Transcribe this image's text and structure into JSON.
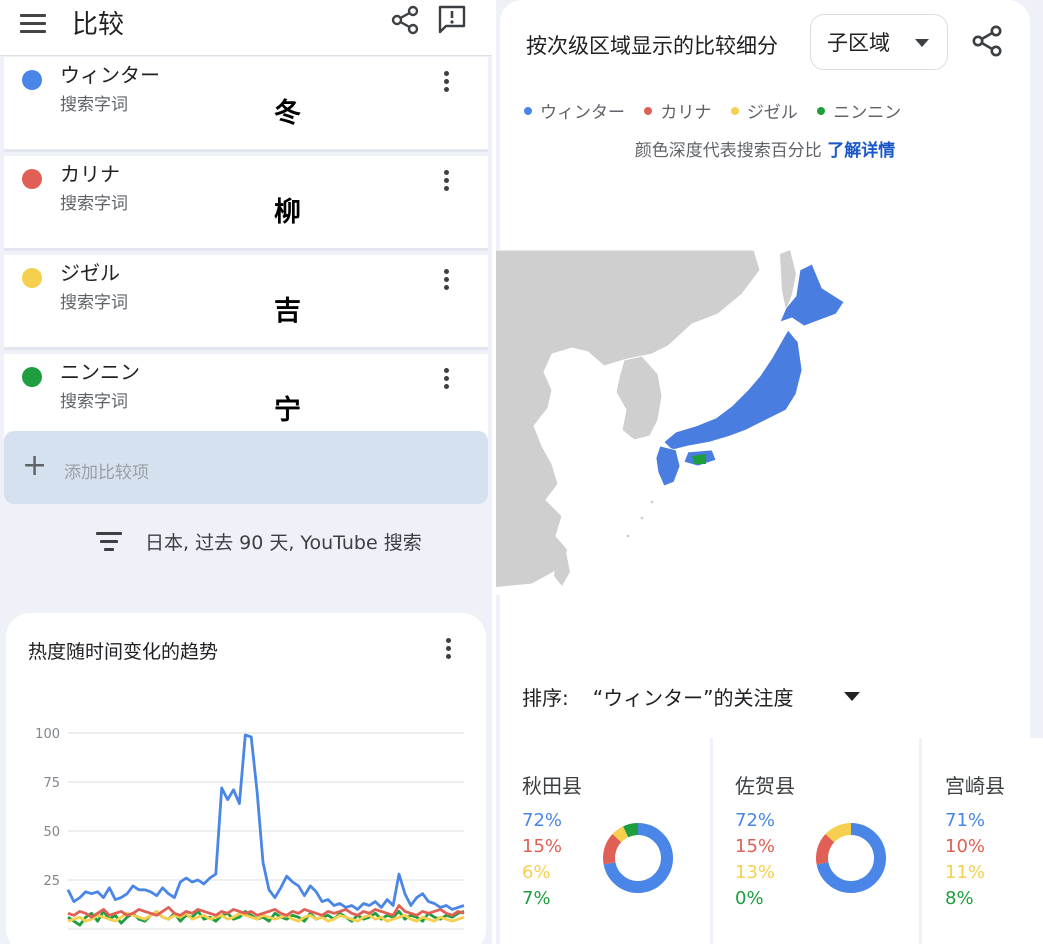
{
  "header": {
    "title": "比较"
  },
  "terms": [
    {
      "name": "ウィンター",
      "sub": "搜索字词",
      "mark": "冬",
      "color": "#4a86e8"
    },
    {
      "name": "カリナ",
      "sub": "搜索字词",
      "mark": "柳",
      "color": "#e06055"
    },
    {
      "name": "ジゼル",
      "sub": "搜索字词",
      "mark": "吉",
      "color": "#f6cf4e"
    },
    {
      "name": "ニンニン",
      "sub": "搜索字词",
      "mark": "宁",
      "color": "#1e9e3e"
    }
  ],
  "add_term": {
    "plus": "+",
    "label": "添加比较项"
  },
  "filter": {
    "text": "日本, 过去 90 天, YouTube 搜索"
  },
  "trend": {
    "title": "热度随时间变化的趋势"
  },
  "chart_data": {
    "type": "line",
    "title": "热度随时间变化的趋势",
    "yticks": [
      25,
      50,
      75,
      100
    ],
    "ylim": [
      0,
      100
    ],
    "grid": true,
    "series": [
      {
        "name": "ウィンター",
        "color": "#4a86e8",
        "values": [
          20,
          14,
          16,
          19,
          18,
          19,
          16,
          21,
          15,
          16,
          18,
          22,
          20,
          20,
          19,
          17,
          21,
          18,
          16,
          24,
          26,
          24,
          25,
          23,
          26,
          28,
          72,
          66,
          71,
          64,
          99,
          98,
          70,
          34,
          20,
          16,
          21,
          27,
          24,
          22,
          17,
          22,
          19,
          14,
          15,
          12,
          13,
          11,
          12,
          10,
          13,
          12,
          14,
          11,
          15,
          12,
          28,
          18,
          12,
          16,
          18,
          14,
          13,
          11,
          12,
          10,
          11,
          12
        ]
      },
      {
        "name": "カリナ",
        "color": "#e06055",
        "values": [
          8,
          7,
          9,
          8,
          6,
          8,
          10,
          7,
          8,
          9,
          7,
          8,
          10,
          9,
          8,
          7,
          9,
          11,
          8,
          7,
          9,
          8,
          10,
          9,
          8,
          7,
          9,
          8,
          10,
          9,
          8,
          9,
          7,
          8,
          9,
          10,
          8,
          7,
          9,
          8,
          10,
          9,
          8,
          7,
          9,
          8,
          9,
          10,
          8,
          7,
          9,
          8,
          10,
          9,
          8,
          7,
          12,
          9,
          8,
          7,
          9,
          8,
          9,
          10,
          8,
          7,
          9,
          8
        ]
      },
      {
        "name": "ジゼル",
        "color": "#f6cf4e",
        "values": [
          4,
          5,
          6,
          4,
          5,
          7,
          6,
          5,
          4,
          6,
          8,
          7,
          6,
          5,
          7,
          9,
          6,
          5,
          7,
          6,
          8,
          5,
          6,
          7,
          5,
          6,
          7,
          5,
          6,
          8,
          7,
          6,
          5,
          7,
          6,
          5,
          6,
          7,
          5,
          4,
          6,
          7,
          5,
          6,
          4,
          5,
          7,
          6,
          5,
          4,
          6,
          7,
          5,
          6,
          4,
          5,
          6,
          7,
          5,
          4,
          6,
          5,
          4,
          6,
          5,
          4,
          5,
          6
        ]
      },
      {
        "name": "ニンニン",
        "color": "#1e9e3e",
        "values": [
          6,
          4,
          2,
          6,
          8,
          4,
          9,
          5,
          7,
          3,
          6,
          8,
          5,
          4,
          7,
          9,
          6,
          5,
          8,
          4,
          7,
          6,
          9,
          5,
          6,
          4,
          7,
          8,
          5,
          6,
          9,
          7,
          5,
          6,
          4,
          8,
          6,
          5,
          7,
          6,
          4,
          8,
          5,
          6,
          7,
          5,
          8,
          6,
          4,
          7,
          5,
          6,
          8,
          5,
          7,
          6,
          9,
          5,
          7,
          6,
          4,
          8,
          6,
          5,
          7,
          6,
          8,
          9
        ]
      }
    ]
  },
  "region": {
    "title": "按次级区域显示的比较细分",
    "select_value": "子区域",
    "color_note_prefix": "颜色深度代表搜索百分比 ",
    "learn_more": "了解详情"
  },
  "sort": {
    "label": "排序:",
    "value": "“ウィンター”的关注度"
  },
  "regions": [
    {
      "name": "秋田县",
      "pcts": [
        "72%",
        "15%",
        "6%",
        "7%"
      ]
    },
    {
      "name": "佐贺县",
      "pcts": [
        "72%",
        "15%",
        "13%",
        "0%"
      ]
    },
    {
      "name": "宫崎县",
      "pcts": [
        "71%",
        "10%",
        "11%",
        "8%"
      ]
    }
  ],
  "region_shares": [
    [
      72,
      15,
      6,
      7
    ],
    [
      72,
      15,
      13,
      0
    ],
    [
      71,
      10,
      11,
      8
    ]
  ],
  "colors": {
    "blue": "#4a86e8",
    "red": "#e06055",
    "yellow": "#f6cf4e",
    "green": "#1e9e3e",
    "map_land": "#cfcfcf",
    "map_japan": "#4a7de0"
  },
  "icons": {
    "menu": "menu-icon",
    "share": "share-icon",
    "feedback": "feedback-icon",
    "more": "more-vert-icon",
    "filter": "filter-icon",
    "plus": "add-icon",
    "caret": "arrow-drop-down-icon"
  }
}
